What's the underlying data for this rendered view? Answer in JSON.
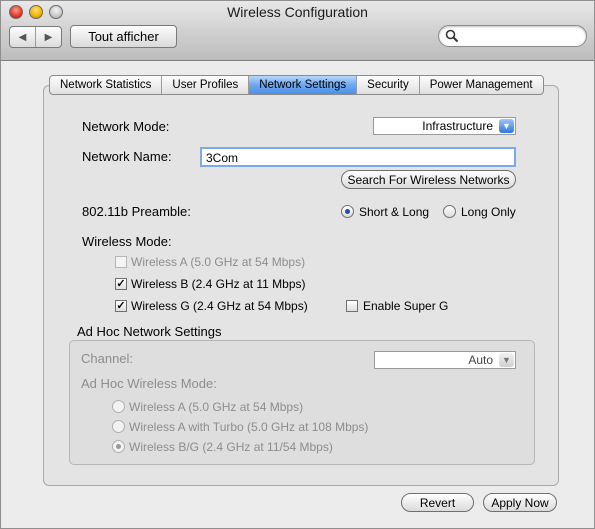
{
  "window": {
    "title": "Wireless Configuration"
  },
  "toolbar": {
    "back_label": "◀",
    "forward_label": "▶",
    "show_all_label": "Tout afficher",
    "search_placeholder": ""
  },
  "tabs": [
    {
      "label": "Network Statistics",
      "active": false
    },
    {
      "label": "User Profiles",
      "active": false
    },
    {
      "label": "Network Settings",
      "active": true
    },
    {
      "label": "Security",
      "active": false
    },
    {
      "label": "Power Management",
      "active": false
    }
  ],
  "settings": {
    "network_mode_label": "Network Mode:",
    "network_mode_value": "Infrastructure",
    "network_name_label": "Network Name:",
    "network_name_value": "3Com",
    "search_networks_button": "Search For Wireless Networks",
    "preamble_label": "802.11b Preamble:",
    "preamble_options": [
      "Short & Long",
      "Long Only"
    ],
    "preamble_selected": "Short & Long",
    "wireless_mode_label": "Wireless Mode:",
    "wireless_modes": [
      {
        "label": "Wireless A (5.0 GHz at 54 Mbps)",
        "checked": false,
        "enabled": false
      },
      {
        "label": "Wireless B (2.4 GHz at 11 Mbps)",
        "checked": true,
        "enabled": true
      },
      {
        "label": "Wireless G (2.4 GHz at 54 Mbps)",
        "checked": true,
        "enabled": true
      }
    ],
    "super_g_label": "Enable Super G",
    "super_g_checked": false
  },
  "adhoc": {
    "section_title": "Ad Hoc Network Settings",
    "channel_label": "Channel:",
    "channel_value": "Auto",
    "mode_label": "Ad Hoc Wireless Mode:",
    "modes": [
      "Wireless A (5.0 GHz at 54 Mbps)",
      "Wireless A with Turbo (5.0 GHz at 108 Mbps)",
      "Wireless B/G (2.4 GHz at 11/54 Mbps)"
    ],
    "selected_index": 2
  },
  "footer": {
    "revert_label": "Revert",
    "apply_label": "Apply Now"
  },
  "colors": {
    "accent": "#4d90e4",
    "disabled_text": "#8d8d8d"
  }
}
